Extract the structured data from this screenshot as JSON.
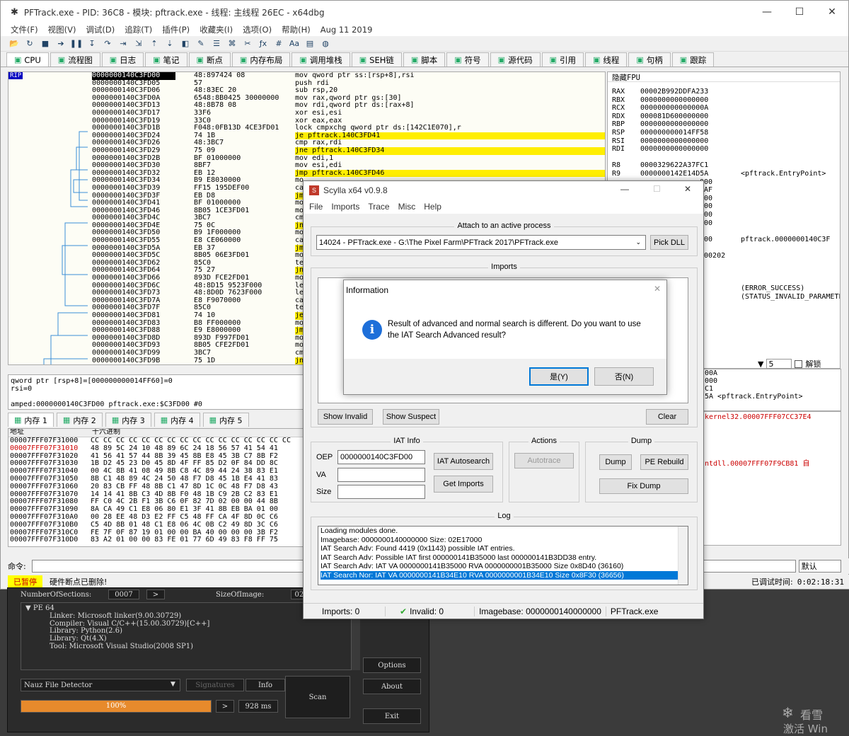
{
  "x64": {
    "title": "PFTrack.exe - PID: 36C8 - 模块: pftrack.exe - 线程: 主线程 26EC - x64dbg",
    "menu": [
      "文件(F)",
      "视图(V)",
      "调试(D)",
      "追踪(T)",
      "插件(P)",
      "收藏夹(I)",
      "选项(O)",
      "帮助(H)",
      "Aug 11 2019"
    ],
    "tabs": [
      "CPU",
      "流程图",
      "日志",
      "笔记",
      "断点",
      "内存布局",
      "调用堆栈",
      "SEH链",
      "脚本",
      "符号",
      "源代码",
      "引用",
      "线程",
      "句柄",
      "跟踪"
    ],
    "rip_label": "RIP",
    "disasm": [
      {
        "a": "0000000140C3FD00",
        "b": "48:897424 08",
        "asm": "mov qword ptr ss:[rsp+8],rsi"
      },
      {
        "a": "0000000140C3FD05",
        "b": "57",
        "asm": "push rdi"
      },
      {
        "a": "0000000140C3FD06",
        "b": "48:83EC 20",
        "asm": "sub rsp,20"
      },
      {
        "a": "0000000140C3FD0A",
        "b": "6548:8B0425 30000000",
        "asm": "mov rax,qword ptr gs:[30]"
      },
      {
        "a": "0000000140C3FD13",
        "b": "48:8B78 08",
        "asm": "mov rdi,qword ptr ds:[rax+8]"
      },
      {
        "a": "0000000140C3FD17",
        "b": "33F6",
        "asm": "xor esi,esi"
      },
      {
        "a": "0000000140C3FD19",
        "b": "33C0",
        "asm": "xor eax,eax"
      },
      {
        "a": "0000000140C3FD1B",
        "b": "F048:0FB13D 4CE3FD01",
        "asm": "lock cmpxchg qword ptr ds:[142C1E070],r"
      },
      {
        "a": "0000000140C3FD24",
        "b": "74 1B",
        "asm": "je pftrack.140C3FD41"
      },
      {
        "a": "0000000140C3FD26",
        "b": "48:3BC7",
        "asm": "cmp rax,rdi"
      },
      {
        "a": "0000000140C3FD29",
        "b": "75 09",
        "asm": "jne pftrack.140C3FD34"
      },
      {
        "a": "0000000140C3FD2B",
        "b": "BF 01000000",
        "asm": "mov edi,1"
      },
      {
        "a": "0000000140C3FD30",
        "b": "8BF7",
        "asm": "mov esi,edi"
      },
      {
        "a": "0000000140C3FD32",
        "b": "EB 12",
        "asm": "jmp pftrack.140C3FD46"
      },
      {
        "a": "0000000140C3FD34",
        "b": "B9 E8030000",
        "asm": "mo"
      },
      {
        "a": "0000000140C3FD39",
        "b": "FF15 195DEF00",
        "asm": "ca"
      },
      {
        "a": "0000000140C3FD3F",
        "b": "EB D8",
        "asm": "jm"
      },
      {
        "a": "0000000140C3FD41",
        "b": "BF 01000000",
        "asm": "mo"
      },
      {
        "a": "0000000140C3FD46",
        "b": "8B05 1CE3FD01",
        "asm": "mo"
      },
      {
        "a": "0000000140C3FD4C",
        "b": "3BC7",
        "asm": "cm"
      },
      {
        "a": "0000000140C3FD4E",
        "b": "75 0C",
        "asm": "jn"
      },
      {
        "a": "0000000140C3FD50",
        "b": "B9 1F000000",
        "asm": "mo"
      },
      {
        "a": "0000000140C3FD55",
        "b": "E8 CE060000",
        "asm": "ca"
      },
      {
        "a": "0000000140C3FD5A",
        "b": "EB 37",
        "asm": "jm"
      },
      {
        "a": "0000000140C3FD5C",
        "b": "8B05 06E3FD01",
        "asm": "mo"
      },
      {
        "a": "0000000140C3FD62",
        "b": "85C0",
        "asm": "te"
      },
      {
        "a": "0000000140C3FD64",
        "b": "75 27",
        "asm": "jn"
      },
      {
        "a": "0000000140C3FD66",
        "b": "893D FCE2FD01",
        "asm": "mo"
      },
      {
        "a": "0000000140C3FD6C",
        "b": "48:8D15 9523F000",
        "asm": "le"
      },
      {
        "a": "0000000140C3FD73",
        "b": "48:8D0D 7623F000",
        "asm": "le"
      },
      {
        "a": "0000000140C3FD7A",
        "b": "E8 F9070000",
        "asm": "ca"
      },
      {
        "a": "0000000140C3FD7F",
        "b": "85C0",
        "asm": "te"
      },
      {
        "a": "0000000140C3FD81",
        "b": "74 10",
        "asm": "je"
      },
      {
        "a": "0000000140C3FD83",
        "b": "B8 FF000000",
        "asm": "mo"
      },
      {
        "a": "0000000140C3FD88",
        "b": "E9 E8000000",
        "asm": "jm"
      },
      {
        "a": "0000000140C3FD8D",
        "b": "893D F997FD01",
        "asm": "mo"
      },
      {
        "a": "0000000140C3FD93",
        "b": "8B05 CFE2FD01",
        "asm": "mo"
      },
      {
        "a": "0000000140C3FD99",
        "b": "3BC7",
        "asm": "cm"
      },
      {
        "a": "0000000140C3FD9B",
        "b": "75 1D",
        "asm": "jn"
      }
    ],
    "regs_header": "隐藏FPU",
    "regs": [
      {
        "n": "RAX",
        "v": "00002B992DDFA233",
        "c": ""
      },
      {
        "n": "RBX",
        "v": "0000000000000000",
        "c": ""
      },
      {
        "n": "RCX",
        "v": "000000000000000A",
        "c": ""
      },
      {
        "n": "RDX",
        "v": "000081D600000000",
        "c": ""
      },
      {
        "n": "RBP",
        "v": "0000000000000000",
        "c": ""
      },
      {
        "n": "RSP",
        "v": "000000000014FF58",
        "c": ""
      },
      {
        "n": "RSI",
        "v": "0000000000000000",
        "c": ""
      },
      {
        "n": "RDI",
        "v": "0000000000000000",
        "c": ""
      },
      {
        "n": "",
        "v": "",
        "c": ""
      },
      {
        "n": "R8",
        "v": "0000329622A37FC1",
        "c": ""
      },
      {
        "n": "R9",
        "v": "0000000142E14D5A",
        "c": "<pftrack.EntryPoint>"
      },
      {
        "n": "",
        "v": "000",
        "c": ""
      },
      {
        "n": "",
        "v": "BAF",
        "c": ""
      },
      {
        "n": "",
        "v": "000",
        "c": ""
      },
      {
        "n": "",
        "v": "000",
        "c": ""
      },
      {
        "n": "",
        "v": "000",
        "c": ""
      },
      {
        "n": "",
        "v": "000",
        "c": ""
      },
      {
        "n": "",
        "v": "",
        "c": ""
      },
      {
        "n": "",
        "v": "D00",
        "c": "pftrack.0000000140C3F"
      },
      {
        "n": "",
        "v": "",
        "c": ""
      },
      {
        "n": "",
        "v": "000202",
        "c": ""
      },
      {
        "n": "",
        "v": "",
        "c": ""
      },
      {
        "n": "",
        "v": "",
        "c": ""
      },
      {
        "n": "",
        "v": "",
        "c": ""
      },
      {
        "n": "",
        "v": "",
        "c": "(ERROR_SUCCESS)"
      },
      {
        "n": "",
        "v": "",
        "c": "(STATUS_INVALID_PARAMETER)"
      }
    ],
    "info_lines": [
      "qword ptr [rsp+8]=[000000000014FF60]=0",
      "rsi=0",
      "",
      "amped:0000000140C3FD00 pftrack.exe:$C3FD00 #0"
    ],
    "dump_tabs": [
      "内存 1",
      "内存 2",
      "内存 3",
      "内存 4",
      "内存 5"
    ],
    "dump_hdr_addr": "地址",
    "dump_hdr_hex": "十六进制",
    "dump": [
      {
        "a": "00007FFF07F31000",
        "b": "CC CC CC CC CC CC CC CC CC CC CC CC CC CC CC CC"
      },
      {
        "a": "00007FFF07F31010",
        "b": "48 89 5C 24 10 48 89 6C 24 18 56 57 41 54 41"
      },
      {
        "a": "00007FFF07F31020",
        "b": "41 56 41 57 44 8B 39 45 8B E8 45 3B C7 8B F2"
      },
      {
        "a": "00007FFF07F31030",
        "b": "1B D2 45 23 D0 45 8D 4F FF 85 D2 0F 84 DD 8C"
      },
      {
        "a": "00007FFF07F31040",
        "b": "00 4C 8B 41 08 49 8B C8 4C 89 44 24 38 83 E1"
      },
      {
        "a": "00007FFF07F31050",
        "b": "8B C1 48 89 4C 24 50 48 F7 D8 45 1B E4 41 83"
      },
      {
        "a": "00007FFF07F31060",
        "b": "20 83 CB FF 48 8B C1 47 8D 1C 0C 48 F7 D8 43"
      },
      {
        "a": "00007FFF07F31070",
        "b": "14 14 41 8B C3 4D 8B F0 48 1B C9 2B C2 83 E1"
      },
      {
        "a": "00007FFF07F31080",
        "b": "FF C0 4C 2B F1 3B C6 0F 82 7D 02 00 00 44 8B"
      },
      {
        "a": "00007FFF07F31090",
        "b": "8A CA 49 C1 E8 06 80 E1 3F 41 8B EB BA 01 00"
      },
      {
        "a": "00007FFF07F310A0",
        "b": "00 28 EE 48 D3 E2 FF C5 48 FF CA 4F 8D 0C C6"
      },
      {
        "a": "00007FFF07F310B0",
        "b": "C5 4D 8B 01 48 C1 E8 06 4C 0B C2 49 8D 3C C6"
      },
      {
        "a": "00007FFF07F310C0",
        "b": "FE 7F 0F 87 19 01 00 00 BA 40 00 00 00 3B F2"
      },
      {
        "a": "00007FFF07F310D0",
        "b": "83 A2 01 00 00 83 FE 01 77 6D 49 83 F8 FF 75"
      }
    ],
    "stack_lines": [
      "00A",
      "000",
      "C1",
      "5A <pftrack.EntryPoint>"
    ],
    "call_lines": [
      "kernel32.00007FFF07CC37E4",
      "",
      "",
      "",
      "",
      "",
      "ntdll.00007FFF07F9CB81 自"
    ],
    "stack_combo": "5",
    "unlock_label": "解锁",
    "cmd_label": "命令:",
    "cmd_default": "默认",
    "paused": "已暂停",
    "status_msg": "硬件断点已删除!",
    "elapsed_label": "已调试时间:",
    "elapsed": "0:02:18:31"
  },
  "nauz": {
    "sections_label": "NumberOfSections:",
    "sections_val": "0007",
    "image_label": "SizeOfImage:",
    "image_val": "024",
    "tree_root": "PE 64",
    "tree_lines": [
      "Linker: Microsoft linker(9.00.30729)",
      "Compiler: Visual C/C++(15.00.30729)[C++]",
      "Library: Python(2.6)",
      "Library: Qt(4.X)",
      "Tool: Microsoft Visual Studio(2008 SP1)"
    ],
    "detector": "Nauz File Detector",
    "signatures": "Signatures",
    "info": "Info",
    "scan": "Scan",
    "options": "Options",
    "about": "About",
    "exit": "Exit",
    "progress_label": "100%",
    "progress": 1.0,
    "time": "928 ms"
  },
  "scylla": {
    "title": "Scylla x64 v0.9.8",
    "menu": [
      "File",
      "Imports",
      "Trace",
      "Misc",
      "Help"
    ],
    "attach_label": "Attach to an active process",
    "process": "14024 - PFTrack.exe - G:\\The Pixel Farm\\PFTrack 2017\\PFTrack.exe",
    "pick_dll": "Pick DLL",
    "imports_label": "Imports",
    "show_invalid": "Show Invalid",
    "show_suspect": "Show Suspect",
    "clear": "Clear",
    "iat_label": "IAT Info",
    "oep_label": "OEP",
    "oep": "0000000140C3FD00",
    "va_label": "VA",
    "size_label": "Size",
    "iat_autosearch": "IAT Autosearch",
    "get_imports": "Get Imports",
    "actions_label": "Actions",
    "autotrace": "Autotrace",
    "dump_label": "Dump",
    "dump": "Dump",
    "pe_rebuild": "PE Rebuild",
    "fix_dump": "Fix Dump",
    "log_label": "Log",
    "log": [
      "Loading modules done.",
      "Imagebase: 0000000140000000 Size: 02E17000",
      "IAT Search Adv: Found 4419 (0x1143) possible IAT entries.",
      "IAT Search Adv: Possible IAT first 000000141B35000 last 000000141B3DD38 entry.",
      "IAT Search Adv: IAT VA 0000000141B35000 RVA 0000000001B35000 Size 0x8D40 (36160)",
      "IAT Search Nor: IAT VA 0000000141B34E10 RVA 0000000001B34E10 Size 0x8F30 (36656)"
    ],
    "status_imports": "Imports: 0",
    "status_invalid": "Invalid: 0",
    "status_imagebase": "Imagebase: 0000000140000000",
    "status_file": "PFTrack.exe"
  },
  "info_dialog": {
    "title": "Information",
    "message": "Result of advanced and normal search is different. Do you want to use the IAT Search Advanced result?",
    "yes": "是(Y)",
    "no": "否(N)"
  },
  "watermark": {
    "line1": "看雪",
    "line2": "激活 Win"
  }
}
